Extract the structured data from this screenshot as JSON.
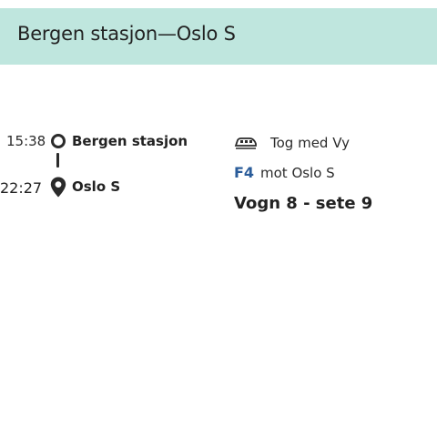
{
  "header": {
    "title": "Bergen stasjon—Oslo S"
  },
  "journey": {
    "departure": {
      "time": "15:38",
      "station": "Bergen stasjon",
      "icon": "origin-circle-icon"
    },
    "arrival": {
      "time": "22:27",
      "station": "Oslo S",
      "icon": "map-pin-icon"
    }
  },
  "service": {
    "icon": "train-icon",
    "operator_label": "Tog med Vy",
    "line_code": "F4",
    "line_color": "#2a5c9a",
    "direction": "mot Oslo S",
    "seat": "Vogn 8 - sete 9"
  },
  "colors": {
    "header_bg": "#bfe6de"
  }
}
